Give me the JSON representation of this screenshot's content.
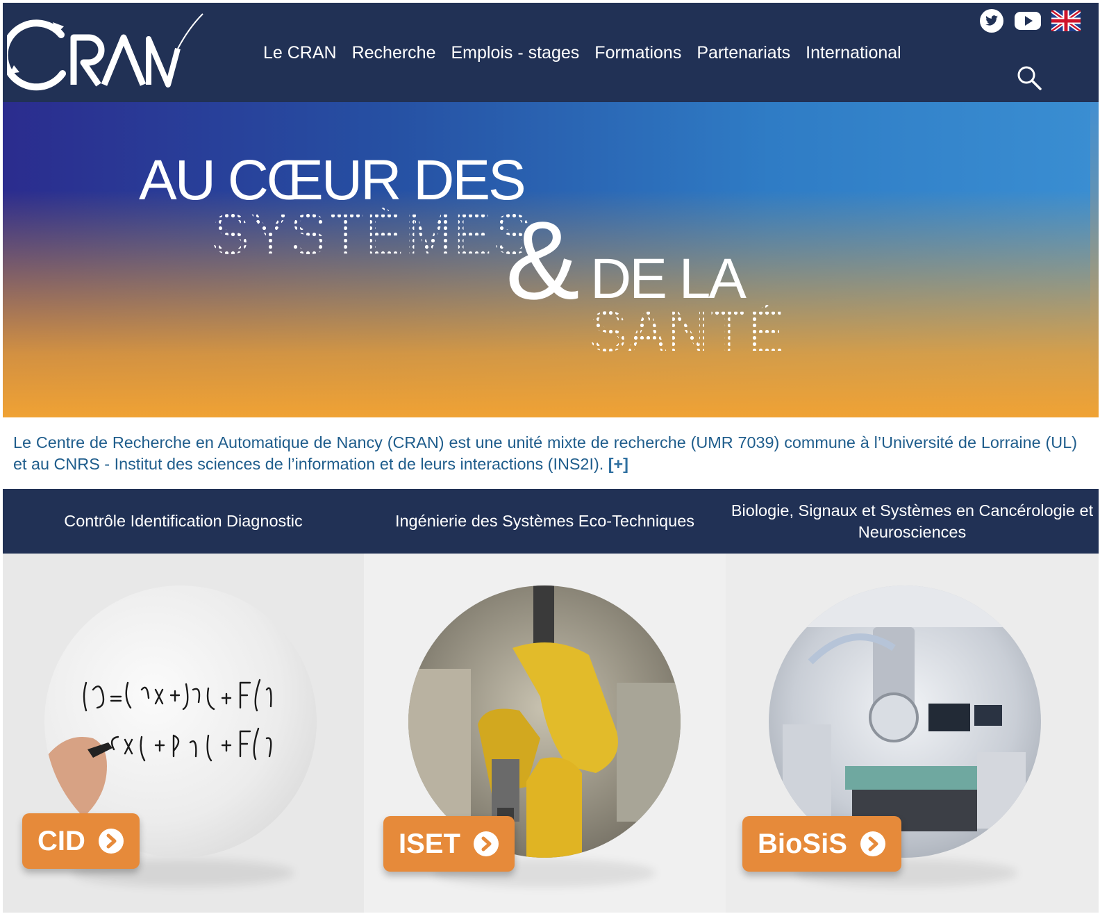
{
  "header": {
    "nav": [
      "Le CRAN",
      "Recherche",
      "Emplois - stages",
      "Formations",
      "Partenariats",
      "International"
    ],
    "social_icons": [
      "twitter-icon",
      "youtube-icon",
      "uk-flag-icon"
    ],
    "search_icon": "search-icon"
  },
  "hero": {
    "line1": "AU CŒUR DES",
    "line2": "SYSTÈMES",
    "amp": "&",
    "line3": "DE LA",
    "line4": "SANTÉ"
  },
  "intro": {
    "text": "Le Centre de Recherche en Automatique de Nancy (CRAN) est une unité mixte de recherche (UMR 7039) commune à l’Université de Lorraine (UL) et au CNRS - Institut des sciences de l’information et de leurs interactions (INS2I). ",
    "more": "[+]"
  },
  "teams": [
    {
      "title": "Contrôle Identification Diagnostic",
      "badge": "CID"
    },
    {
      "title": "Ingénierie des Systèmes Eco-Techniques",
      "badge": "ISET"
    },
    {
      "title": "Biologie, Signaux et Systèmes en Cancérologie et Neurosciences",
      "badge": "BioSiS"
    }
  ],
  "colors": {
    "header_bg": "#213155",
    "badge_orange": "#e68a3a",
    "intro_text": "#1f5d8c"
  }
}
